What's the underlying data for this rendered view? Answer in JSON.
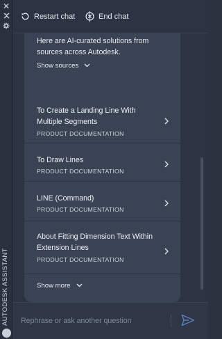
{
  "rail": {
    "icons": [
      "close-icon",
      "collapse-icon",
      "settings-icon"
    ],
    "label": "AUTODESK ASSISTANT"
  },
  "header": {
    "restart_label": "Restart chat",
    "end_label": "End chat"
  },
  "top_card": {
    "intro": "Here are AI-curated solutions from sources across Autodesk.",
    "show_sources": "Show sources"
  },
  "results": [
    {
      "title": "To Create a Landing Line With Multiple Segments",
      "category": "PRODUCT DOCUMENTATION"
    },
    {
      "title": "To Draw Lines",
      "category": "PRODUCT DOCUMENTATION"
    },
    {
      "title": "LINE (Command)",
      "category": "PRODUCT DOCUMENTATION"
    },
    {
      "title": "About Fitting Dimension Text Within Extension Lines",
      "category": "PRODUCT DOCUMENTATION"
    }
  ],
  "show_more": "Show more",
  "input": {
    "placeholder": "Rephrase or ask another question",
    "value": ""
  },
  "colors": {
    "background": "#2c3443",
    "card": "#3a4353",
    "accent": "#5b7fb8"
  }
}
